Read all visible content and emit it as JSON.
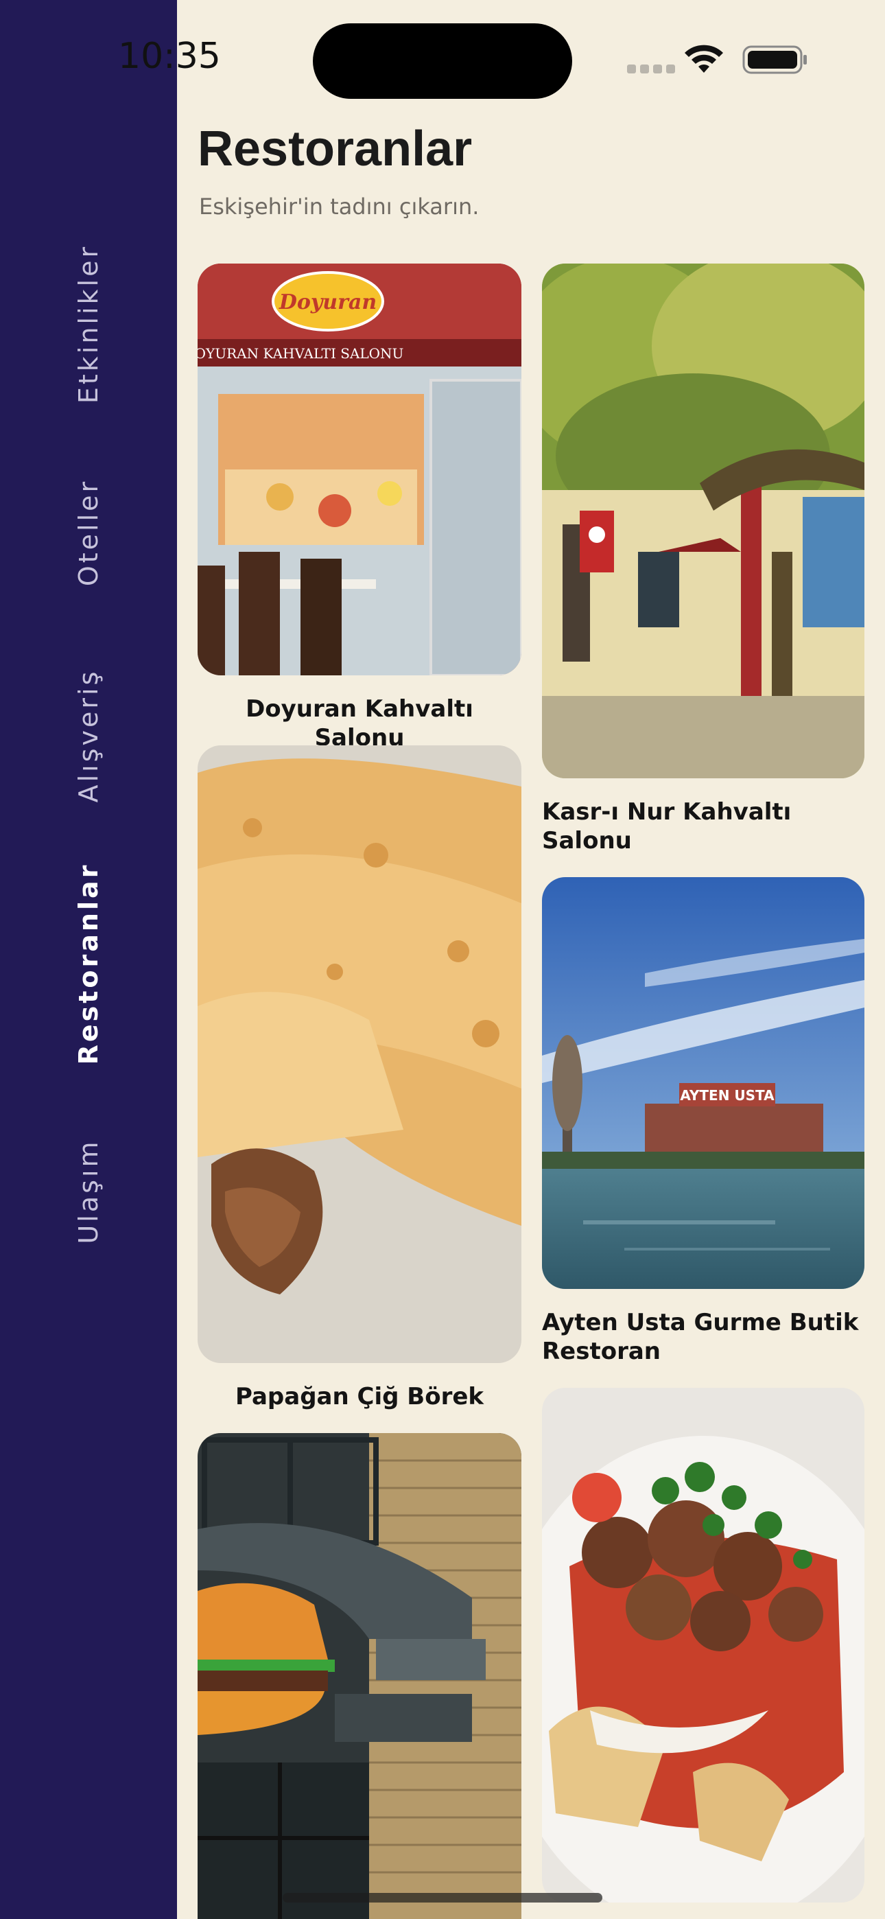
{
  "status_bar": {
    "time": "10:35",
    "icons": [
      "cellular-signal-icon",
      "wifi-icon",
      "battery-icon"
    ]
  },
  "sidebar": {
    "items": [
      {
        "label": "Etkinlikler",
        "active": false
      },
      {
        "label": "Oteller",
        "active": false
      },
      {
        "label": "Alışveriş",
        "active": false
      },
      {
        "label": "Restoranlar",
        "active": true
      },
      {
        "label": "Ulaşım",
        "active": false
      }
    ]
  },
  "header": {
    "title": "Restoranlar",
    "subtitle": "Eskişehir'in tadını çıkarın."
  },
  "restaurants": [
    {
      "name": "Doyuran Kahvaltı Salonu",
      "photo_sign": "DOYURAN KAHVALTI SALONU",
      "photo_logo": "Doyuran"
    },
    {
      "name": "Kasr-ı Nur Kahvaltı Salonu"
    },
    {
      "name": "Papağan Çiğ Börek"
    },
    {
      "name": "Ayten Usta Gurme Butik Restoran",
      "photo_sign": "AYTEN USTA"
    },
    {
      "name": ""
    },
    {
      "name": ""
    }
  ],
  "colors": {
    "sidebar_bg": "#221a56",
    "page_bg": "#f4eedf",
    "active_nav": "#ffffff",
    "inactive_nav": "#c7c3dc"
  }
}
